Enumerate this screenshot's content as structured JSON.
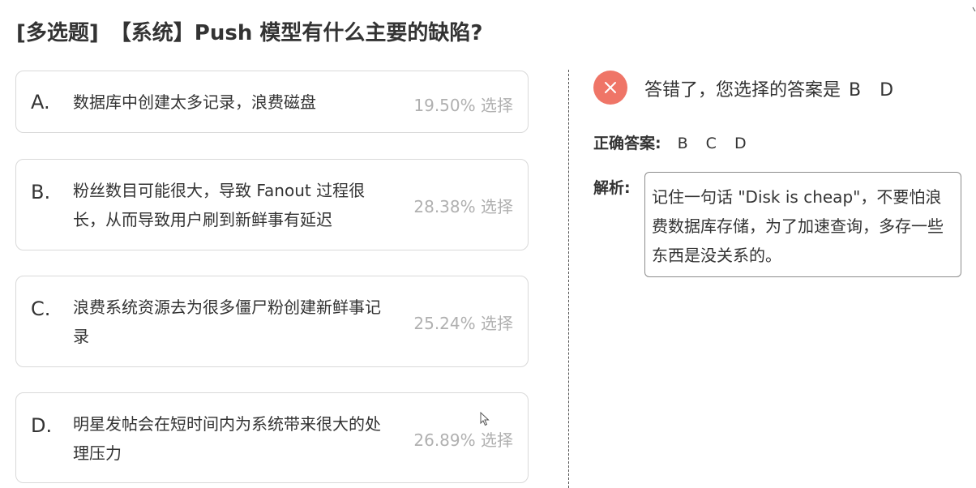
{
  "question": {
    "type_label": "[多选题]",
    "title": "【系统】Push 模型有什么主要的缺陷?"
  },
  "options": [
    {
      "letter": "A.",
      "text": "数据库中创建太多记录，浪费磁盘",
      "stat": "19.50% 选择"
    },
    {
      "letter": "B.",
      "text": "粉丝数目可能很大，导致 Fanout 过程很长，从而导致用户刷到新鲜事有延迟",
      "stat": "28.38% 选择"
    },
    {
      "letter": "C.",
      "text": "浪费系统资源去为很多僵尸粉创建新鲜事记录",
      "stat": "25.24% 选择"
    },
    {
      "letter": "D.",
      "text": "明星发帖会在短时间内为系统带来很大的处理压力",
      "stat": "26.89% 选择"
    }
  ],
  "result": {
    "icon": "close-icon",
    "status_color": "#ef7567",
    "message": "答错了，您选择的答案是",
    "selected": "B D"
  },
  "correct_answer": {
    "label": "正确答案:",
    "value": "B C D"
  },
  "analysis": {
    "label": "解析:",
    "text": "记住一句话 \"Disk is cheap\"，不要怕浪费数据库存储，为了加速查询，多存一些东西是没关系的。"
  }
}
